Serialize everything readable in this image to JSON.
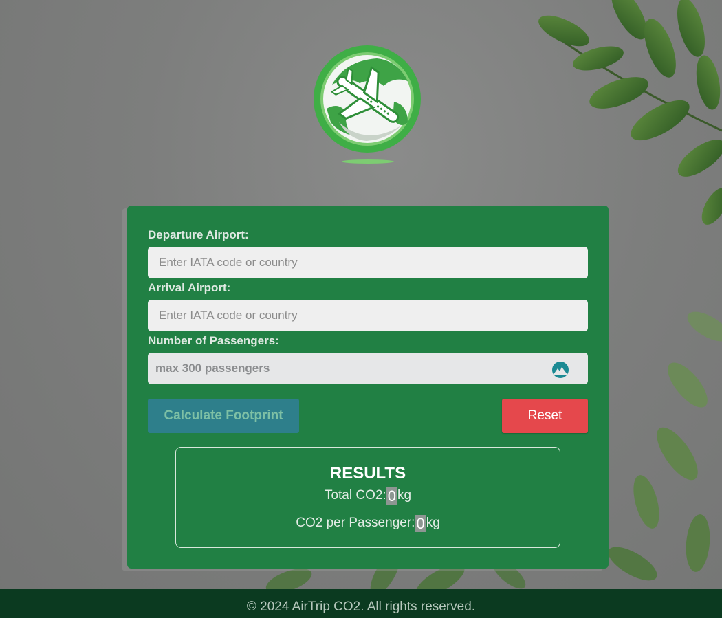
{
  "app": {
    "brand_color": "#218044",
    "accent_calc": "#2e7f8b",
    "accent_reset": "#e5484c",
    "logo": "globe-airplane-logo"
  },
  "form": {
    "departure_label": "Departure Airport:",
    "departure_placeholder": "Enter IATA code or country",
    "departure_value": "",
    "arrival_label": "Arrival Airport:",
    "arrival_placeholder": "Enter IATA code or country",
    "arrival_value": "",
    "passengers_label": "Number of Passengers:",
    "passengers_placeholder": "max 300 passengers",
    "passengers_value": "",
    "passengers_icon": "autofill-extension-icon"
  },
  "buttons": {
    "calculate": "Calculate Footprint",
    "reset": "Reset"
  },
  "results": {
    "title": "RESULTS",
    "total_label": "Total CO2:",
    "total_value": "0",
    "total_unit": "kg",
    "per_passenger_label": "CO2 per Passenger:",
    "per_passenger_value": "0",
    "per_passenger_unit": "kg"
  },
  "footer": {
    "text": "© 2024 AirTrip CO2. All rights reserved."
  }
}
